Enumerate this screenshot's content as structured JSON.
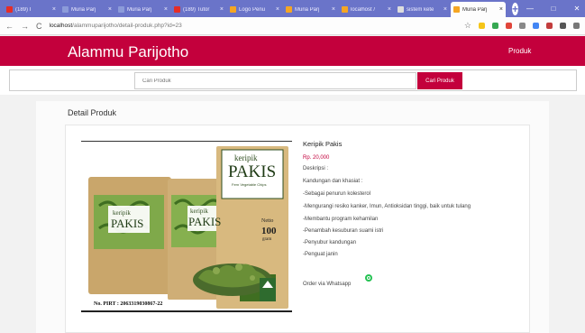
{
  "browser": {
    "tabs": [
      {
        "title": "(189) I",
        "color": "#e52d27"
      },
      {
        "title": "Muria Parj",
        "color": "#8c9bd9"
      },
      {
        "title": "Muria Parj",
        "color": "#8c9bd9"
      },
      {
        "title": "(189) Tutor",
        "color": "#e52d27"
      },
      {
        "title": "Logo Penu",
        "color": "#f5a623"
      },
      {
        "title": "Muria Parj",
        "color": "#f5a623"
      },
      {
        "title": "localhost /",
        "color": "#f5a623"
      },
      {
        "title": "sistem kete",
        "color": "#dddddd"
      },
      {
        "title": "Muria Parj",
        "color": "#f5a623"
      }
    ],
    "new_tab": "+",
    "window_buttons": [
      "—",
      "□",
      "✕"
    ],
    "url_host": "localhost",
    "url_path": "/alammuparijotho/detail-produk.php?id=23",
    "ext_colors": [
      "#f5c518",
      "#36a852",
      "#e0453a",
      "#888888",
      "#4285f4",
      "#c23c3c",
      "#555555",
      "#777777"
    ]
  },
  "header": {
    "site_title": "Alammu Parijotho",
    "nav_produk": "Produk"
  },
  "search": {
    "placeholder": "Cari Produk",
    "button_label": "Cari Produk"
  },
  "main": {
    "section_title": "Detail Produk",
    "product": {
      "name": "Keripik Pakis",
      "price": "Rp. 20,000",
      "desc_label": "Deskripsi :",
      "lines": [
        "Kandungan dan khasiat :",
        "-Sebagai penurun kolesterol",
        "-Mengurangi resiko kanker, Imun, Antioksidan tinggi, baik untuk tulang",
        "-Membantu program kehamilan",
        "-Penambah kesuburan suami istri",
        "-Penyubur kandungan",
        "-Penguat janin"
      ],
      "order_text": "Order via Whatsapp"
    },
    "image": {
      "brand_top": "keripik",
      "brand_main": "PAKIS",
      "brand_sub": "Fern Vegetable Chips",
      "netto_label": "Netto",
      "netto_value": "100",
      "netto_unit": "gram",
      "pirt": "No. PIRT : 2063319030867-22"
    }
  }
}
